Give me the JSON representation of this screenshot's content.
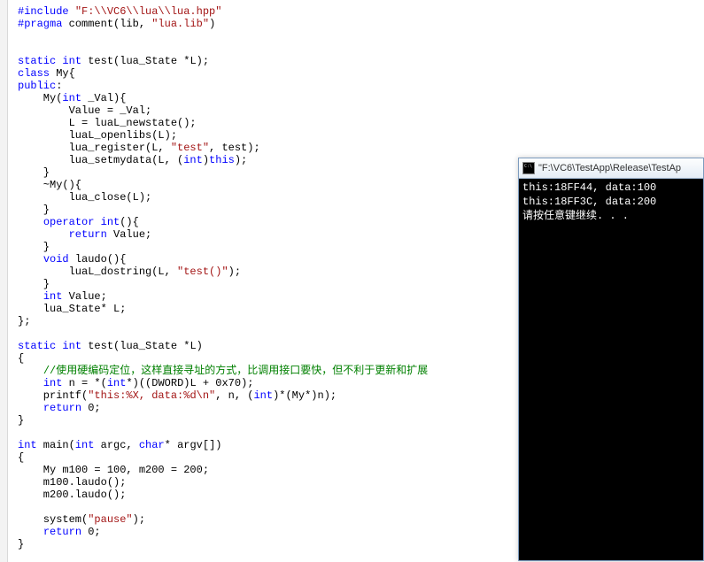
{
  "editor": {
    "code_lines": [
      {
        "segs": [
          {
            "t": "#include ",
            "c": "pp"
          },
          {
            "t": "\"F:\\\\VC6\\\\lua\\\\lua.hpp\"",
            "c": "str"
          }
        ]
      },
      {
        "segs": [
          {
            "t": "#pragma",
            "c": "pp"
          },
          {
            "t": " comment(lib, ",
            "c": ""
          },
          {
            "t": "\"lua.lib\"",
            "c": "str"
          },
          {
            "t": ")",
            "c": ""
          }
        ]
      },
      {
        "segs": [
          {
            "t": "",
            "c": ""
          }
        ]
      },
      {
        "segs": [
          {
            "t": "",
            "c": ""
          }
        ]
      },
      {
        "segs": [
          {
            "t": "static",
            "c": "kw"
          },
          {
            "t": " ",
            "c": ""
          },
          {
            "t": "int",
            "c": "kw"
          },
          {
            "t": " test(lua_State *L);",
            "c": ""
          }
        ]
      },
      {
        "segs": [
          {
            "t": "class",
            "c": "kw"
          },
          {
            "t": " My{",
            "c": ""
          }
        ]
      },
      {
        "segs": [
          {
            "t": "public",
            "c": "kw"
          },
          {
            "t": ":",
            "c": ""
          }
        ]
      },
      {
        "segs": [
          {
            "t": "    My(",
            "c": ""
          },
          {
            "t": "int",
            "c": "kw"
          },
          {
            "t": " _Val){",
            "c": ""
          }
        ]
      },
      {
        "segs": [
          {
            "t": "        Value = _Val;",
            "c": ""
          }
        ]
      },
      {
        "segs": [
          {
            "t": "        L = luaL_newstate();",
            "c": ""
          }
        ]
      },
      {
        "segs": [
          {
            "t": "        luaL_openlibs(L);",
            "c": ""
          }
        ]
      },
      {
        "segs": [
          {
            "t": "        lua_register(L, ",
            "c": ""
          },
          {
            "t": "\"test\"",
            "c": "str"
          },
          {
            "t": ", test);",
            "c": ""
          }
        ]
      },
      {
        "segs": [
          {
            "t": "        lua_setmydata(L, (",
            "c": ""
          },
          {
            "t": "int",
            "c": "kw"
          },
          {
            "t": ")",
            "c": ""
          },
          {
            "t": "this",
            "c": "kw"
          },
          {
            "t": ");",
            "c": ""
          }
        ]
      },
      {
        "segs": [
          {
            "t": "    }",
            "c": ""
          }
        ]
      },
      {
        "segs": [
          {
            "t": "    ~My(){",
            "c": ""
          }
        ]
      },
      {
        "segs": [
          {
            "t": "        lua_close(L);",
            "c": ""
          }
        ]
      },
      {
        "segs": [
          {
            "t": "    }",
            "c": ""
          }
        ]
      },
      {
        "segs": [
          {
            "t": "    ",
            "c": ""
          },
          {
            "t": "operator",
            "c": "kw"
          },
          {
            "t": " ",
            "c": ""
          },
          {
            "t": "int",
            "c": "kw"
          },
          {
            "t": "(){",
            "c": ""
          }
        ]
      },
      {
        "segs": [
          {
            "t": "        ",
            "c": ""
          },
          {
            "t": "return",
            "c": "kw"
          },
          {
            "t": " Value;",
            "c": ""
          }
        ]
      },
      {
        "segs": [
          {
            "t": "    }",
            "c": ""
          }
        ]
      },
      {
        "segs": [
          {
            "t": "    ",
            "c": ""
          },
          {
            "t": "void",
            "c": "kw"
          },
          {
            "t": " laudo(){",
            "c": ""
          }
        ]
      },
      {
        "segs": [
          {
            "t": "        luaL_dostring(L, ",
            "c": ""
          },
          {
            "t": "\"test()\"",
            "c": "str"
          },
          {
            "t": ");",
            "c": ""
          }
        ]
      },
      {
        "segs": [
          {
            "t": "    }",
            "c": ""
          }
        ]
      },
      {
        "segs": [
          {
            "t": "    ",
            "c": ""
          },
          {
            "t": "int",
            "c": "kw"
          },
          {
            "t": " Value;",
            "c": ""
          }
        ]
      },
      {
        "segs": [
          {
            "t": "    lua_State* L;",
            "c": ""
          }
        ]
      },
      {
        "segs": [
          {
            "t": "};",
            "c": ""
          }
        ]
      },
      {
        "segs": [
          {
            "t": "",
            "c": ""
          }
        ]
      },
      {
        "segs": [
          {
            "t": "static",
            "c": "kw"
          },
          {
            "t": " ",
            "c": ""
          },
          {
            "t": "int",
            "c": "kw"
          },
          {
            "t": " test(lua_State *L)",
            "c": ""
          }
        ]
      },
      {
        "segs": [
          {
            "t": "{",
            "c": ""
          }
        ]
      },
      {
        "segs": [
          {
            "t": "    ",
            "c": ""
          },
          {
            "t": "//使用硬编码定位，这样直接寻址的方式，比调用接口要快，但不利于更新和扩展",
            "c": "cm"
          }
        ]
      },
      {
        "segs": [
          {
            "t": "    ",
            "c": ""
          },
          {
            "t": "int",
            "c": "kw"
          },
          {
            "t": " n = *(",
            "c": ""
          },
          {
            "t": "int",
            "c": "kw"
          },
          {
            "t": "*)((DWORD)L + 0x70);",
            "c": ""
          }
        ]
      },
      {
        "segs": [
          {
            "t": "    printf(",
            "c": ""
          },
          {
            "t": "\"this:%X, data:%d\\n\"",
            "c": "str"
          },
          {
            "t": ", n, (",
            "c": ""
          },
          {
            "t": "int",
            "c": "kw"
          },
          {
            "t": ")*(My*)n);",
            "c": ""
          }
        ]
      },
      {
        "segs": [
          {
            "t": "    ",
            "c": ""
          },
          {
            "t": "return",
            "c": "kw"
          },
          {
            "t": " 0;",
            "c": ""
          }
        ]
      },
      {
        "segs": [
          {
            "t": "}",
            "c": ""
          }
        ]
      },
      {
        "segs": [
          {
            "t": "",
            "c": ""
          }
        ]
      },
      {
        "segs": [
          {
            "t": "int",
            "c": "kw"
          },
          {
            "t": " main(",
            "c": ""
          },
          {
            "t": "int",
            "c": "kw"
          },
          {
            "t": " argc, ",
            "c": ""
          },
          {
            "t": "char",
            "c": "kw"
          },
          {
            "t": "* argv[])",
            "c": ""
          }
        ]
      },
      {
        "segs": [
          {
            "t": "{",
            "c": ""
          }
        ]
      },
      {
        "segs": [
          {
            "t": "    My m100 = 100, m200 = 200;",
            "c": ""
          }
        ]
      },
      {
        "segs": [
          {
            "t": "    m100.laudo();",
            "c": ""
          }
        ]
      },
      {
        "segs": [
          {
            "t": "    m200.laudo();",
            "c": ""
          }
        ]
      },
      {
        "segs": [
          {
            "t": "",
            "c": ""
          }
        ]
      },
      {
        "segs": [
          {
            "t": "    system(",
            "c": ""
          },
          {
            "t": "\"pause\"",
            "c": "str"
          },
          {
            "t": ");",
            "c": ""
          }
        ]
      },
      {
        "segs": [
          {
            "t": "    ",
            "c": ""
          },
          {
            "t": "return",
            "c": "kw"
          },
          {
            "t": " 0;",
            "c": ""
          }
        ]
      },
      {
        "segs": [
          {
            "t": "}",
            "c": ""
          }
        ]
      }
    ]
  },
  "console": {
    "title": "\"F:\\VC6\\TestApp\\Release\\TestAp",
    "lines": [
      "this:18FF44, data:100",
      "this:18FF3C, data:200",
      "请按任意键继续. . ."
    ]
  }
}
